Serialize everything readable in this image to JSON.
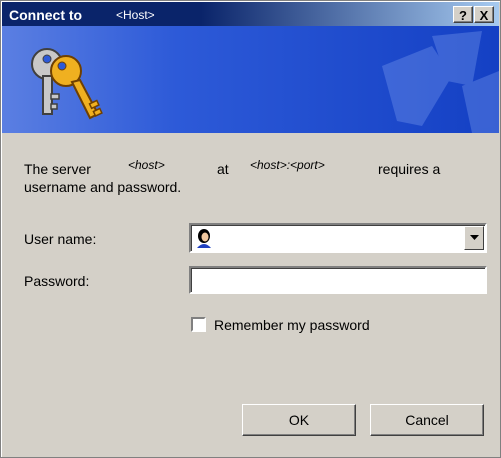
{
  "window": {
    "title": "Connect to",
    "title_host": "<Host>",
    "help_label": "?",
    "close_label": "X"
  },
  "message": {
    "part1": "The server",
    "host": "<host>",
    "part2": "at",
    "hostport": "<host>:<port>",
    "part3": "requires a",
    "line2": "username and password."
  },
  "form": {
    "username_label": "User name:",
    "username_value": "",
    "password_label": "Password:",
    "password_value": "",
    "remember_label": "Remember my password",
    "remember_checked": false
  },
  "buttons": {
    "ok": "OK",
    "cancel": "Cancel"
  },
  "icons": {
    "banner": "keys-icon",
    "user": "user-icon",
    "dropdown": "chevron-down-icon"
  },
  "colors": {
    "titlebar_start": "#0a246a",
    "banner": "#2d5ad8",
    "face": "#d4d0c8"
  }
}
